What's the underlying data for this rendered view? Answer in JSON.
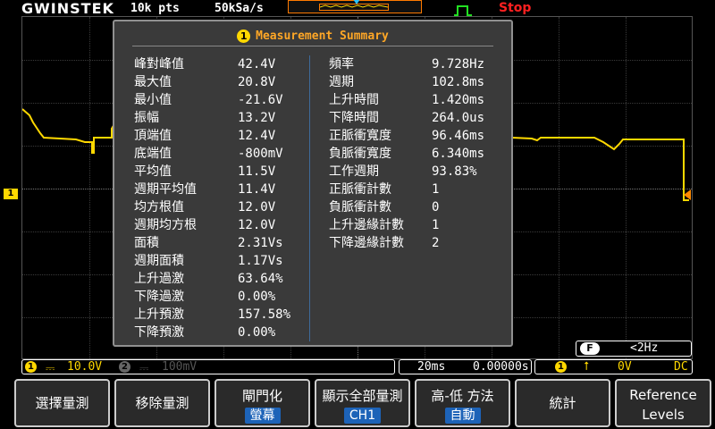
{
  "top": {
    "brand": "GWINSTEK",
    "record_length": "10k pts",
    "sample_rate": "50kSa/s",
    "run_state": "Stop"
  },
  "panel": {
    "badge": "1",
    "title": "Measurement Summary",
    "left": [
      {
        "label": "峰對峰值",
        "value": "42.4V"
      },
      {
        "label": "最大值",
        "value": "20.8V"
      },
      {
        "label": "最小值",
        "value": "-21.6V"
      },
      {
        "label": "振幅",
        "value": "13.2V"
      },
      {
        "label": "頂端值",
        "value": "12.4V"
      },
      {
        "label": "底端值",
        "value": "-800mV"
      },
      {
        "label": "平均值",
        "value": "11.5V"
      },
      {
        "label": "週期平均值",
        "value": "11.4V"
      },
      {
        "label": "均方根值",
        "value": "12.0V"
      },
      {
        "label": "週期均方根",
        "value": "12.0V"
      },
      {
        "label": "面積",
        "value": "2.31Vs"
      },
      {
        "label": "週期面積",
        "value": "1.17Vs"
      },
      {
        "label": "上升過激",
        "value": "63.64%"
      },
      {
        "label": "下降過激",
        "value": "0.00%"
      },
      {
        "label": "上升預激",
        "value": "157.58%"
      },
      {
        "label": "下降預激",
        "value": "0.00%"
      }
    ],
    "right": [
      {
        "label": "頻率",
        "value": "9.728Hz"
      },
      {
        "label": "週期",
        "value": "102.8ms"
      },
      {
        "label": "上升時間",
        "value": "1.420ms"
      },
      {
        "label": "下降時間",
        "value": "264.0us"
      },
      {
        "label": "正脈衝寬度",
        "value": "96.46ms"
      },
      {
        "label": "負脈衝寬度",
        "value": "6.340ms"
      },
      {
        "label": "工作週期",
        "value": "93.83%"
      },
      {
        "label": "正脈衝計數",
        "value": "1"
      },
      {
        "label": "負脈衝計數",
        "value": "0"
      },
      {
        "label": "上升邊緣計數",
        "value": "1"
      },
      {
        "label": "下降邊緣計數",
        "value": "2"
      }
    ]
  },
  "markers": {
    "ch1": "1"
  },
  "freq_counter": {
    "icon_label": "F",
    "value": "<2Hz"
  },
  "status": {
    "ch1_num": "1",
    "ch1_scale": "10.0V",
    "ch2_num": "2",
    "ch2_scale": "100mV",
    "timebase": "20ms",
    "position": "0.00000s",
    "trig_source": "1",
    "trig_level": "0V",
    "trig_coupling": "DC"
  },
  "menu": [
    {
      "label": "選擇量測",
      "sub": ""
    },
    {
      "label": "移除量測",
      "sub": ""
    },
    {
      "label": "閘門化",
      "sub": "螢幕"
    },
    {
      "label": "顯示全部量測",
      "sub": "CH1"
    },
    {
      "label": "高-低 方法",
      "sub": "自動"
    },
    {
      "label": "統計",
      "sub": ""
    },
    {
      "label": "Reference Levels",
      "sub": ""
    }
  ],
  "colors": {
    "ch1": "#ffd800",
    "accent": "#ffa726",
    "stop": "#ff2020",
    "softkey_value_bg": "#1d63b8"
  },
  "icons": [
    "run-stop-square-icon",
    "trigger-rising-edge-icon"
  ]
}
